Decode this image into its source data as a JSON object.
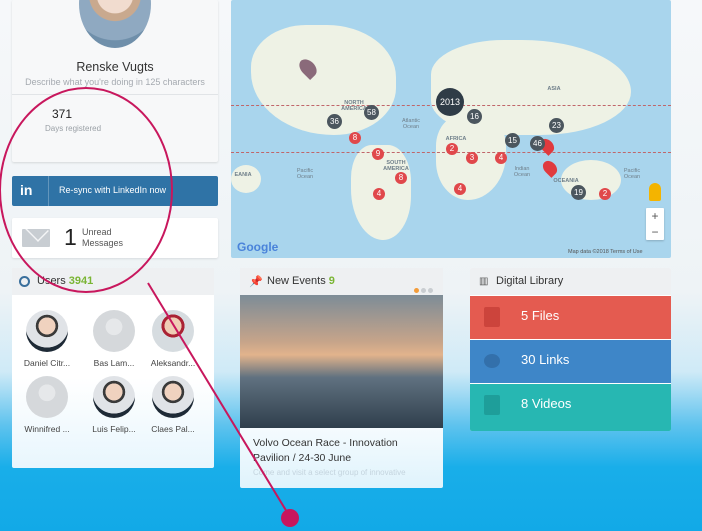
{
  "profile": {
    "name": "Renske Vugts",
    "description_placeholder": "Describe what you're doing in 125 characters",
    "days_registered_value": "371",
    "days_registered_label": "Days registered"
  },
  "linkedin": {
    "icon": "in",
    "label": "Re-sync with LinkedIn now"
  },
  "messages": {
    "count": "1",
    "label_line1": "Unread",
    "label_line2": "Messages"
  },
  "users": {
    "title": "Users",
    "count": "3941",
    "people": [
      {
        "name": "Daniel Citr..."
      },
      {
        "name": "Bas Lam..."
      },
      {
        "name": "Aleksandr..."
      },
      {
        "name": "Winnifred ..."
      },
      {
        "name": "Luis Felip..."
      },
      {
        "name": "Claes Pal..."
      }
    ]
  },
  "map": {
    "continent_labels": [
      "NORTH AMERICA",
      "SOUTH AMERICA",
      "AFRICA",
      "ASIA",
      "OCEANIA",
      "EANIA"
    ],
    "ocean_labels": [
      "Atlantic Ocean",
      "Pacific Ocean",
      "Pacific Ocean",
      "Indian Ocean"
    ],
    "clusters": [
      "2013",
      "16",
      "36",
      "58",
      "23",
      "15",
      "46",
      "19",
      "9",
      "8",
      "4",
      "2",
      "3",
      "4",
      "8",
      "2",
      "4"
    ],
    "google_label": "Google",
    "attribution": "Map data ©2018  Terms of Use",
    "zoom_in": "+",
    "zoom_out": "−"
  },
  "events": {
    "title": "New Events",
    "count": "9",
    "item_title": "Volvo Ocean Race - Innovation Pavilion / 24-30 June",
    "item_desc": "Come and visit a select group of innovative"
  },
  "library": {
    "title": "Digital Library",
    "rows": [
      {
        "label": "5 Files",
        "color": "#e45b50"
      },
      {
        "label": "30 Links",
        "color": "#3e86c8"
      },
      {
        "label": "8 Videos",
        "color": "#27b7b2"
      }
    ]
  },
  "colors": {
    "accent": "#c8175d",
    "linkedin": "#2f73a6",
    "users_count": "#7ab534"
  }
}
